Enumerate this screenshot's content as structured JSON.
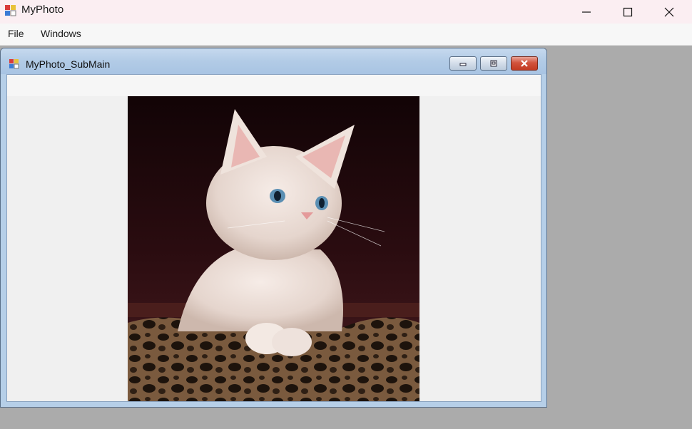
{
  "window": {
    "title": "MyPhoto",
    "icon": "app-icon"
  },
  "menu": {
    "items": [
      {
        "label": "File"
      },
      {
        "label": "Windows"
      }
    ]
  },
  "child_window": {
    "title": "MyPhoto_SubMain",
    "icon": "app-icon",
    "image": {
      "subject": "kitten-photo"
    }
  },
  "colors": {
    "titlebar": "#fbeef2",
    "mdi_background": "#ababab",
    "child_frame": "#b6cfe8",
    "close_button": "#c94a33"
  }
}
